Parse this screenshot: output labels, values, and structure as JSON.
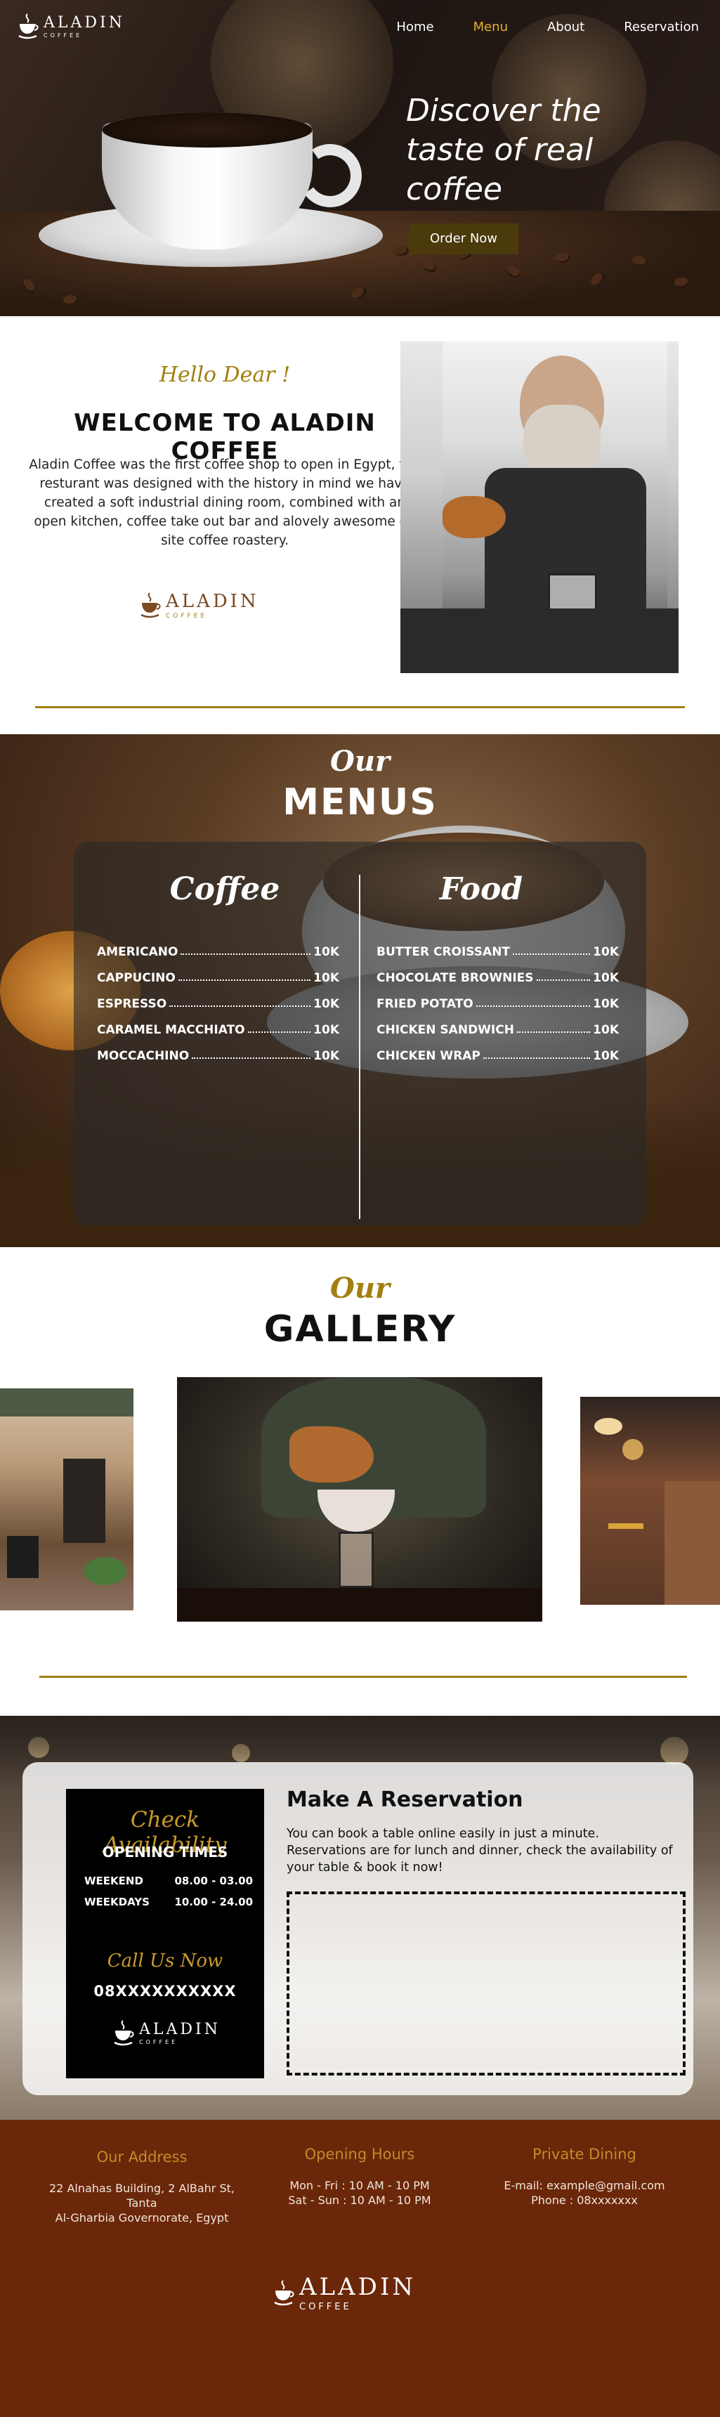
{
  "brand": {
    "name": "ALADIN",
    "tagline": "COFFEE"
  },
  "nav": {
    "items": [
      {
        "label": "Home",
        "active": false
      },
      {
        "label": "Menu",
        "active": true
      },
      {
        "label": "About",
        "active": false
      },
      {
        "label": "Reservation",
        "active": false
      }
    ]
  },
  "hero": {
    "title": "Discover the taste of real coffee",
    "cta": "Order Now"
  },
  "welcome": {
    "greeting": "Hello Dear !",
    "title": "WELCOME TO ALADIN COFFEE",
    "text": "Aladin Coffee was the first coffee shop to open in Egypt, the resturant was designed with the history in mind we have created a soft industrial dining room, combined with an open kitchen, coffee take out bar and alovely awesome on site coffee roastery."
  },
  "menus": {
    "our": "Our",
    "title": "MENUS",
    "coffee": {
      "heading": "Coffee",
      "items": [
        {
          "name": "AMERICANO",
          "price": "10K"
        },
        {
          "name": "CAPPUCINO",
          "price": "10K"
        },
        {
          "name": "ESPRESSO",
          "price": "10K"
        },
        {
          "name": "CARAMEL MACCHIATO",
          "price": "10K"
        },
        {
          "name": "MOCCACHINO",
          "price": "10K"
        }
      ]
    },
    "food": {
      "heading": "Food",
      "items": [
        {
          "name": "BUTTER CROISSANT",
          "price": "10K"
        },
        {
          "name": "CHOCOLATE BROWNIES",
          "price": "10K"
        },
        {
          "name": "FRIED POTATO",
          "price": "10K"
        },
        {
          "name": "CHICKEN SANDWICH",
          "price": "10K"
        },
        {
          "name": "CHICKEN WRAP",
          "price": "10K"
        }
      ]
    }
  },
  "gallery": {
    "our": "Our",
    "title": "GALLERY"
  },
  "reservation": {
    "check": "Check Availability",
    "opening_title": "OPENING TIMES",
    "hours": [
      {
        "day": "WEEKEND",
        "time": "08.00 - 03.00"
      },
      {
        "day": "WEEKDAYS",
        "time": "10.00 - 24.00"
      }
    ],
    "call": "Call Us Now",
    "phone": "08XXXXXXXXXX",
    "title": "Make A Reservation",
    "text": "You can book a table online easily in just a minute. Reservations are for lunch and dinner, check the availability of your table & book it now!"
  },
  "footer": {
    "address": {
      "heading": "Our Address",
      "line1": "22 Alnahas Building, 2 AlBahr St,",
      "line2": "Tanta",
      "line3": "Al-Gharbia Governorate, Egypt"
    },
    "hours": {
      "heading": "Opening Hours",
      "line1": "Mon - Fri : 10 AM - 10 PM",
      "line2": "Sat - Sun : 10 AM - 10 PM"
    },
    "private": {
      "heading": "Private Dining",
      "line1": "E-mail: example@gmail.com",
      "line2": "Phone : 08xxxxxxx"
    }
  },
  "colors": {
    "gold": "#a27f10",
    "accent": "#e3b12a",
    "footer": "#6b2709",
    "button": "#4a3a0c"
  }
}
